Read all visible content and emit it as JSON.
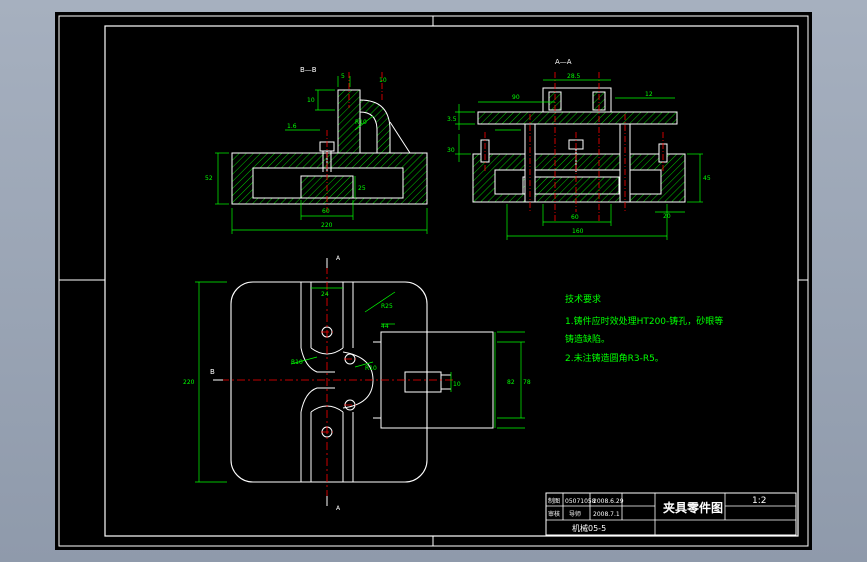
{
  "drawing": {
    "title": "夹具零件图",
    "scale": "1:2",
    "course": "机械05-5",
    "title_block": {
      "designer_label": "制图",
      "student_no": "05071058",
      "date1": "2008.6.29",
      "reviewer_label": "审核",
      "reviewer_name": "导师",
      "date2": "2008.7.1"
    }
  },
  "section_labels": {
    "bb": "B—B",
    "aa": "A—A",
    "a_top": "A",
    "a_bottom": "A",
    "b_left": "B"
  },
  "notes": {
    "heading": "技术要求",
    "line1": "1.铸件应时效处理HT200-铸孔，砂眼等",
    "line2": "铸造缺陷。",
    "line3": "2.未注铸造圆角R3-R5。"
  },
  "dimensions": {
    "bb_width_total": "220",
    "bb_inner": "60",
    "bb_height": "52",
    "bb_h2": "25",
    "bb_top_w": "5",
    "bb_top_h": "10",
    "bb_slot": "10",
    "bb_fillet": "R10",
    "bb_small": "1.6",
    "aa_width_total": "160",
    "aa_inner": "60",
    "aa_top": "28.5",
    "aa_left_top": "90",
    "aa_h1": "3.5",
    "aa_h2": "30",
    "aa_height": "45",
    "aa_right_top": "12",
    "aa_right_small": "20",
    "plan_height": "220",
    "plan_width_top": "24",
    "plan_right_h": "78",
    "plan_right_h2": "82",
    "plan_top_right": "44",
    "plan_radius": "R25",
    "plan_r1": "R10",
    "plan_r2": "R10",
    "plan_pin": "10"
  },
  "colors": {
    "background": "#000000",
    "outline": "#ffffff",
    "hatch": "#00ff00",
    "dimension": "#00ff00",
    "centerline": "#ff0000",
    "accent_red": "#ff2020"
  }
}
